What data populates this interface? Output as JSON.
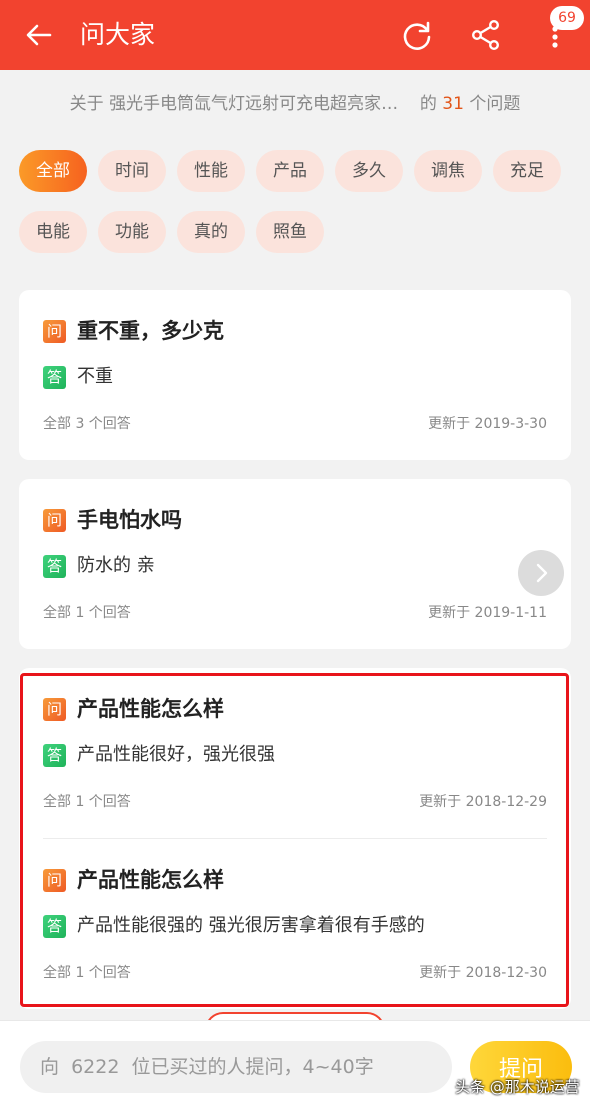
{
  "header": {
    "title": "问大家",
    "badge": "69",
    "icons": [
      "back-arrow-icon",
      "refresh-icon",
      "share-icon",
      "more-vertical-icon"
    ]
  },
  "subtitle": {
    "prefix": "关于",
    "product": "强光手电筒氙气灯远射可充电超亮家用户外",
    "middle": "的",
    "count": "31",
    "suffix": "个问题"
  },
  "tags": [
    "全部",
    "时间",
    "性能",
    "产品",
    "多久",
    "调焦",
    "充足",
    "电能",
    "功能",
    "真的",
    "照鱼"
  ],
  "questions": [
    {
      "q_badge": "问",
      "question": "重不重，多少克",
      "a_badge": "答",
      "answer": "不重",
      "answers_count": "全部 3 个回答",
      "updated": "更新于 2019-3-30"
    },
    {
      "q_badge": "问",
      "question": "手电怕水吗",
      "a_badge": "答",
      "answer": "防水的 亲",
      "answers_count": "全部 1 个回答",
      "updated": "更新于 2019-1-11"
    },
    {
      "q_badge": "问",
      "question": "产品性能怎么样",
      "a_badge": "答",
      "answer": "产品性能很好，强光很强",
      "answers_count": "全部 1 个回答",
      "updated": "更新于 2018-12-29"
    },
    {
      "q_badge": "问",
      "question": "产品性能怎么样",
      "a_badge": "答",
      "answer": "产品性能很强的 强光很厉害拿着很有手感的",
      "answers_count": "全部 1 个回答",
      "updated": "更新于 2018-12-30"
    }
  ],
  "bottom": {
    "placeholder": "向  6222  位已买过的人提问，4~40字",
    "ask_label": "提问"
  },
  "watermark": "头条 @那木说运营",
  "colors": {
    "header": "#f2432f",
    "accent": "#f6621f",
    "answer": "#1fb35a",
    "ask": "#fbbd0e"
  }
}
